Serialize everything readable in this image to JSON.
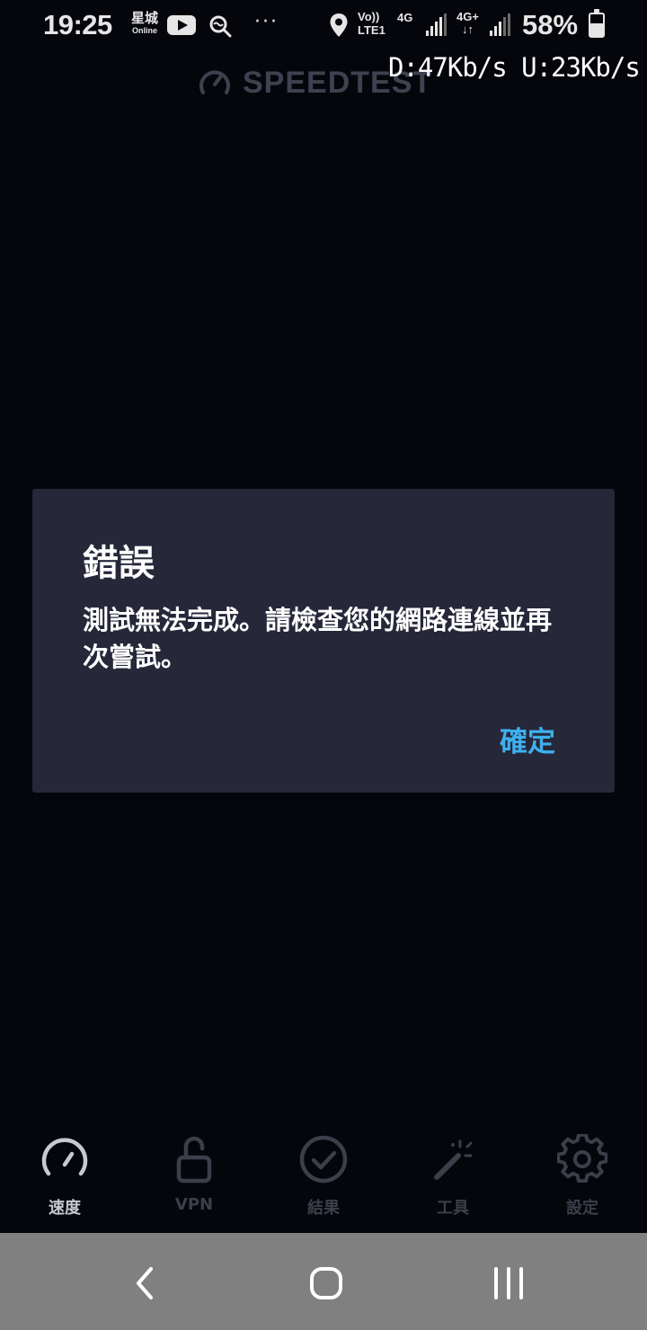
{
  "status_bar": {
    "time": "19:25",
    "carrier_top": "星城",
    "carrier_bottom": "Online",
    "volte_line1": "Vo))",
    "volte_line2": "LTE1",
    "network_a": "4G",
    "network_b": "4G+",
    "network_b_arrows": "↓↑",
    "battery_percent": "58%",
    "battery_level": 0.58,
    "icons": [
      "youtube-icon",
      "search-app-icon",
      "more-dots-icon",
      "location-pin-icon",
      "signal-icon",
      "battery-icon"
    ]
  },
  "app_header": {
    "logo_text": "SPEEDTEST",
    "logo_icon": "speedometer-icon"
  },
  "speed_overlay": {
    "text": "D:47Kb/s U:23Kb/s"
  },
  "dialog": {
    "title": "錯誤",
    "message": "測試無法完成。請檢查您的網路連線並再次嘗試。",
    "ok_label": "確定",
    "ok_color": "#3fb0ee",
    "background": "#262739"
  },
  "tabs": [
    {
      "label": "速度",
      "icon": "speedometer-icon",
      "active": true
    },
    {
      "label": "VPN",
      "icon": "unlock-icon",
      "active": false
    },
    {
      "label": "結果",
      "icon": "check-circle-icon",
      "active": false
    },
    {
      "label": "工具",
      "icon": "magic-wand-icon",
      "active": false
    },
    {
      "label": "設定",
      "icon": "gear-icon",
      "active": false
    }
  ],
  "nav_bar": {
    "buttons": [
      "back-icon",
      "home-icon",
      "recents-icon"
    ]
  }
}
